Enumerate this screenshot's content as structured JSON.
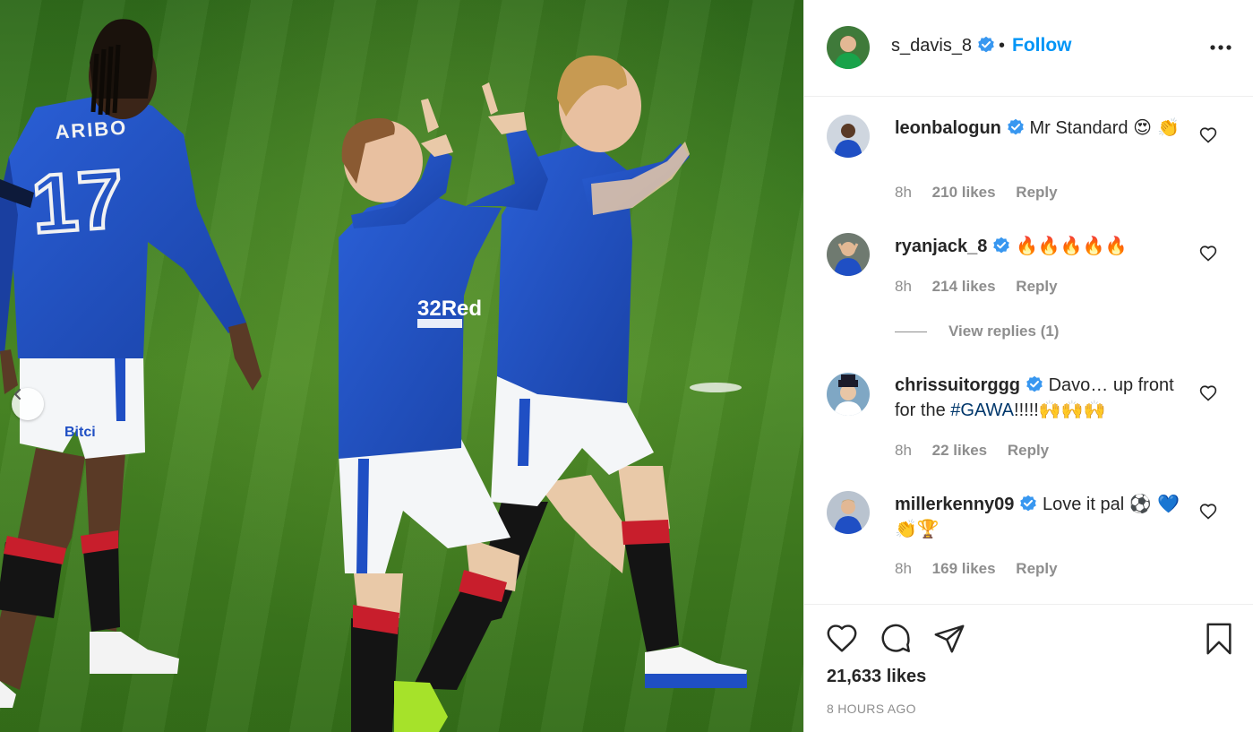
{
  "post": {
    "author": "s_davis_8",
    "follow_label": "Follow",
    "separator": "•",
    "likes": "21,633 likes",
    "time_ago": "8 HOURS AGO"
  },
  "photo": {
    "left_player_name": "ARIBO",
    "left_player_number": "17",
    "sponsor_text": "32Red",
    "shorts_sponsor": "Bitci"
  },
  "comments": [
    {
      "user": "leonbalogun",
      "text": "Mr Standard",
      "emoji": "😍 👏",
      "time": "8h",
      "likes": "210 likes",
      "reply": "Reply"
    },
    {
      "user": "ryanjack_8",
      "text": "",
      "emoji": "🔥🔥🔥🔥🔥",
      "time": "8h",
      "likes": "214 likes",
      "reply": "Reply"
    },
    {
      "user": "chrissuitorggg",
      "text": "Davo… up front for the",
      "hashtag": "#GAWA",
      "text_after": "!!!!!",
      "emoji": "🙌🙌🙌",
      "time": "8h",
      "likes": "22 likes",
      "reply": "Reply"
    },
    {
      "user": "millerkenny09",
      "text": "Love it pal",
      "emoji": "⚽ 💙👏🏆",
      "time": "8h",
      "likes": "169 likes",
      "reply": "Reply"
    }
  ],
  "view_replies": "View replies (1)",
  "icons": {
    "verified": "verified-badge-icon",
    "more": "more-options-icon",
    "like": "heart-icon",
    "comment": "comment-bubble-icon",
    "share": "paper-plane-icon",
    "save": "bookmark-icon",
    "prev": "chevron-left-icon"
  },
  "colors": {
    "follow_blue": "#0095f6",
    "verified_blue": "#3897f0",
    "kit_blue": "#1f4fc4",
    "hashtag": "#00376b",
    "muted": "#8e8e8e"
  }
}
